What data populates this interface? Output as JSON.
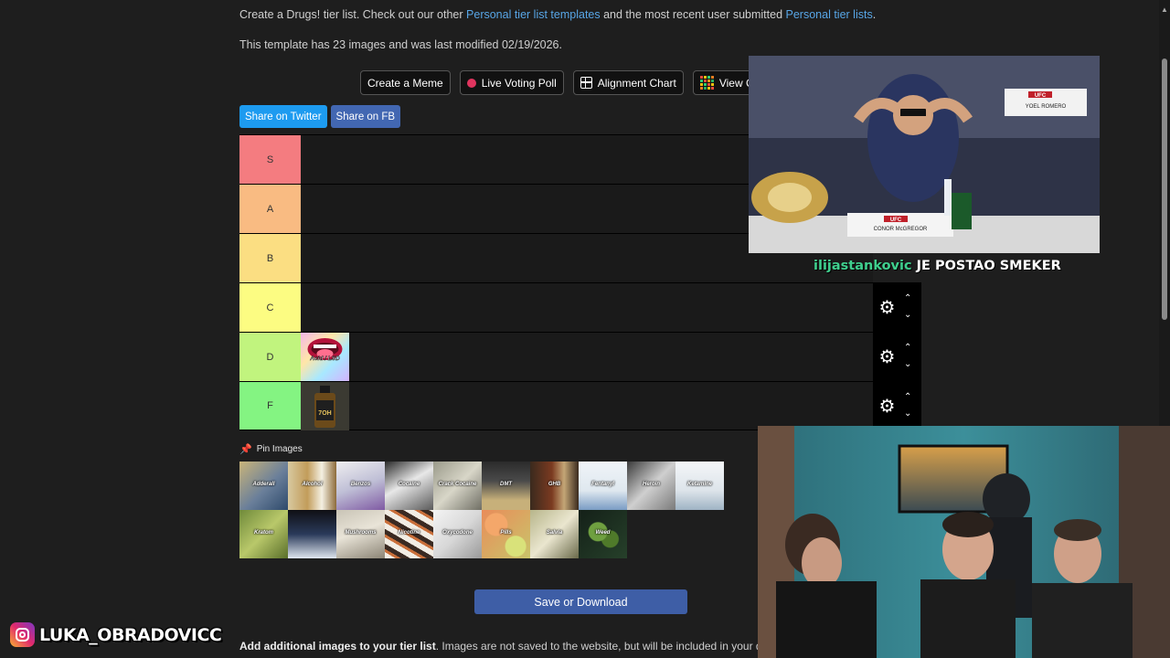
{
  "intro": {
    "prefix": "Create a Drugs! tier list. Check out our other ",
    "link1": "Personal tier list templates",
    "middle": " and the most recent user submitted ",
    "link2": "Personal tier lists",
    "suffix": "."
  },
  "template_info": "This template has 23 images and was last modified 02/19/2026.",
  "toolbar": {
    "meme": "Create a Meme",
    "poll": "Live Voting Poll",
    "alignment": "Alignment Chart",
    "community": "View Comm"
  },
  "share": {
    "twitter": "Share on Twitter",
    "fb": "Share on FB"
  },
  "tiers": [
    {
      "label": "S",
      "color": "#f47c80"
    },
    {
      "label": "A",
      "color": "#f9bb82"
    },
    {
      "label": "B",
      "color": "#fbde82"
    },
    {
      "label": "C",
      "color": "#fcfc82"
    },
    {
      "label": "D",
      "color": "#c1f47e"
    },
    {
      "label": "F",
      "color": "#84f482"
    }
  ],
  "tier_items": {
    "d": "Acid / LSD",
    "f": "7OH"
  },
  "pin_label": "Pin Images",
  "pool": [
    "Adderall",
    "Alcohol",
    "Benzos",
    "Cocaine",
    "Crack Cocaine",
    "DMT",
    "GHB",
    "Fentanyl",
    "Heroin",
    "Ketamine",
    "Kratom",
    "",
    "Mushrooms",
    "Nicotine",
    "Oxycodone",
    "Pills",
    "Salvia",
    "Weed"
  ],
  "save_button": "Save or Download",
  "add_images": {
    "bold": "Add additional images to your tier list",
    "rest": ". Images are not saved to the website, but will be included in your downlo"
  },
  "stream": {
    "alert_user": "ilijastankovic",
    "alert_msg": " JE POSTAO SMEKER",
    "video_texts": [
      "UFC",
      "YOEL ROMERO",
      "CONOR McGREGOR"
    ]
  },
  "instagram_handle": "LUKA_OBRADOVICC"
}
